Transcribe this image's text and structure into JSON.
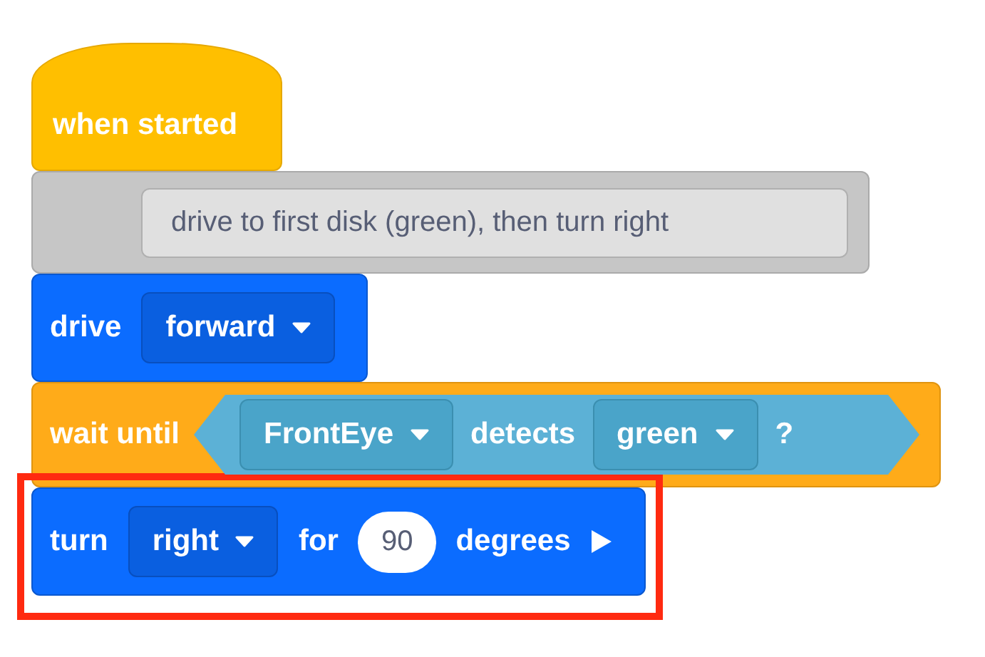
{
  "blocks": [
    {
      "kind": "hat",
      "highlighted": false,
      "parts": [
        {
          "kind": "text",
          "text": "when started"
        }
      ]
    },
    {
      "kind": "comment",
      "highlighted": false,
      "parts": [
        {
          "kind": "note",
          "text": "drive to first disk (green), then turn right"
        }
      ]
    },
    {
      "kind": "motion",
      "highlighted": false,
      "parts": [
        {
          "kind": "text",
          "text": "drive"
        },
        {
          "kind": "dropdown",
          "text": "forward"
        }
      ]
    },
    {
      "kind": "control",
      "highlighted": false,
      "parts": [
        {
          "kind": "text",
          "text": "wait until"
        },
        {
          "kind": "condition",
          "parts": [
            {
              "kind": "dropdown",
              "text": "FrontEye"
            },
            {
              "kind": "text",
              "text": "detects"
            },
            {
              "kind": "dropdown",
              "text": "green"
            },
            {
              "kind": "text",
              "text": "?"
            }
          ]
        }
      ]
    },
    {
      "kind": "motion",
      "highlighted": true,
      "parts": [
        {
          "kind": "text",
          "text": "turn"
        },
        {
          "kind": "dropdown",
          "text": "right"
        },
        {
          "kind": "text",
          "text": "for"
        },
        {
          "kind": "number",
          "text": "90"
        },
        {
          "kind": "text",
          "text": "degrees"
        },
        {
          "kind": "play"
        }
      ]
    }
  ]
}
